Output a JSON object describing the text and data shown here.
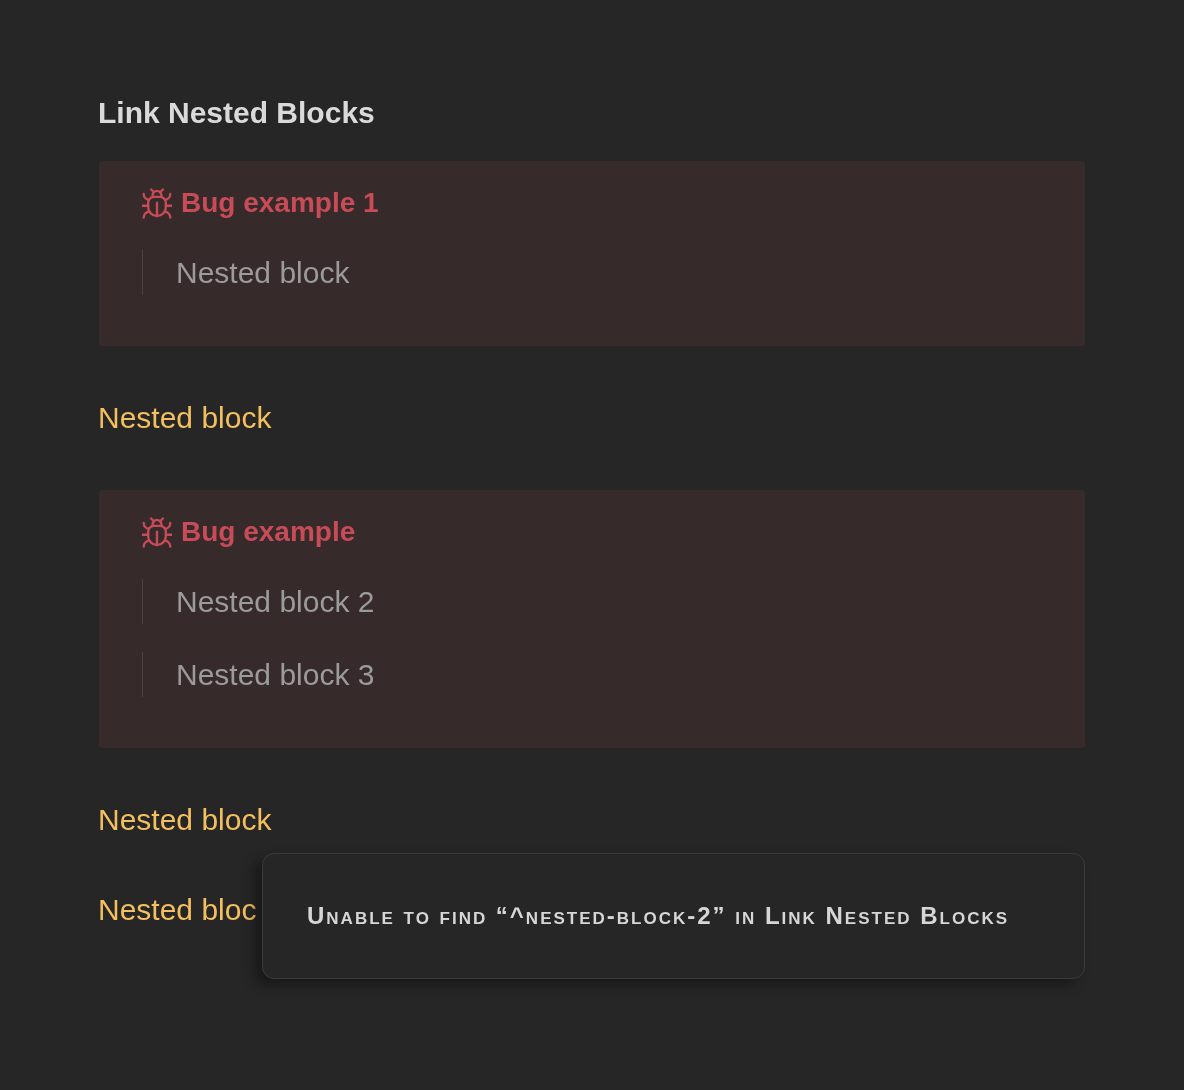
{
  "page": {
    "title": "Link Nested Blocks"
  },
  "blocks": [
    {
      "kind": "callout",
      "title": "Bug example 1",
      "items": [
        "Nested block"
      ]
    },
    {
      "kind": "link",
      "text": "Nested block"
    },
    {
      "kind": "callout",
      "title": "Bug example",
      "items": [
        "Nested block 2",
        "Nested block 3"
      ]
    },
    {
      "kind": "link",
      "text": "Nested block"
    },
    {
      "kind": "link",
      "text": "Nested bloc"
    }
  ],
  "popover": {
    "message": "Unable to find “^nested-block-2” in Link Nested Blocks"
  }
}
